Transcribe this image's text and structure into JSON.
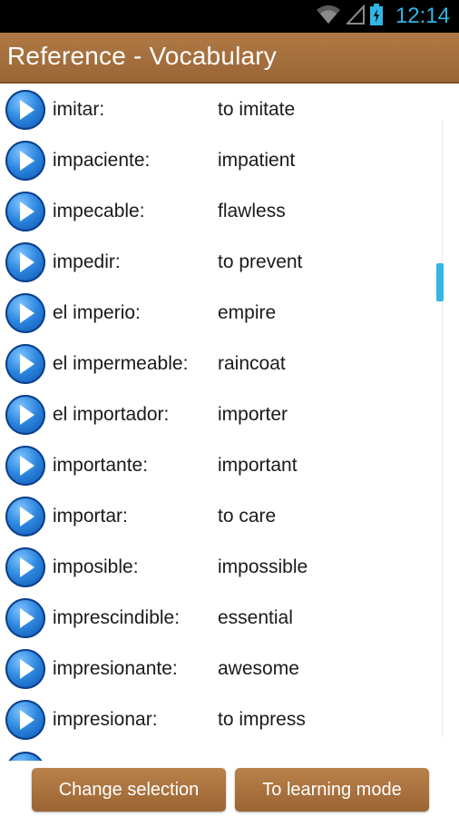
{
  "status_bar": {
    "time": "12:14",
    "icons": [
      "wifi-icon",
      "signal-icon",
      "battery-icon"
    ]
  },
  "header": {
    "title": "Reference - Vocabulary"
  },
  "vocabulary": [
    {
      "term": "imitar:",
      "translation": "to imitate"
    },
    {
      "term": "impaciente:",
      "translation": "impatient"
    },
    {
      "term": "impecable:",
      "translation": "flawless"
    },
    {
      "term": "impedir:",
      "translation": "to prevent"
    },
    {
      "term": "el imperio:",
      "translation": "empire"
    },
    {
      "term": "el impermeable:",
      "translation": "raincoat"
    },
    {
      "term": "el importador:",
      "translation": "importer"
    },
    {
      "term": "importante:",
      "translation": "important"
    },
    {
      "term": "importar:",
      "translation": "to care"
    },
    {
      "term": "imposible:",
      "translation": "impossible"
    },
    {
      "term": "imprescindible:",
      "translation": "essential"
    },
    {
      "term": "impresionante:",
      "translation": "awesome"
    },
    {
      "term": "impresionar:",
      "translation": "to impress"
    }
  ],
  "footer": {
    "change_selection_label": "Change selection",
    "learning_mode_label": "To learning mode"
  },
  "colors": {
    "accent": "#33b5e5",
    "header_brown": "#a36e3c",
    "button_brown": "#a87240"
  }
}
